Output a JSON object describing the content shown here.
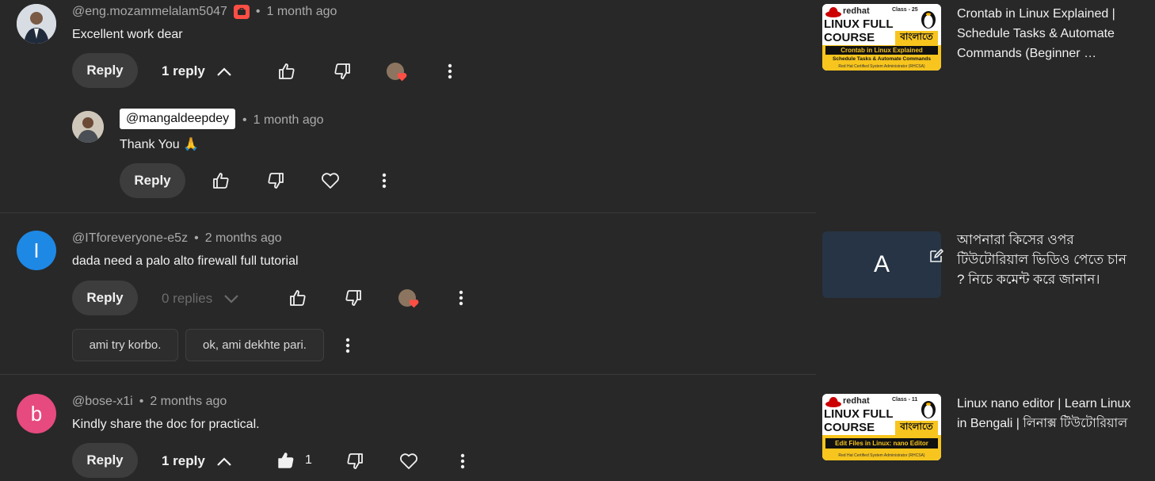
{
  "comments": [
    {
      "author": "@eng.mozammelalam5047",
      "time": "1 month ago",
      "text": "Excellent work dear",
      "reply_label": "Reply",
      "replies_label": "1 reply"
    },
    {
      "author": "@ITforeveryone-e5z",
      "avatar_letter": "I",
      "avatar_color": "#1e88e5",
      "time": "2 months ago",
      "text": "dada need a palo alto firewall full tutorial",
      "reply_label": "Reply",
      "replies_label": "0 replies",
      "suggestions": [
        "ami try korbo.",
        "ok, ami dekhte pari."
      ]
    },
    {
      "author": "@bose-x1i",
      "avatar_letter": "b",
      "avatar_color": "#e64a7f",
      "time": "2 months ago",
      "text": "Kindly share the doc for practical.",
      "reply_label": "Reply",
      "replies_label": "1 reply",
      "like_count": "1"
    }
  ],
  "reply": {
    "author": "@mangaldeepdey",
    "time": "1 month ago",
    "text": "Thank You 🙏",
    "reply_label": "Reply"
  },
  "videos": [
    {
      "title": "Crontab in Linux Explained | Schedule Tasks & Automate Commands (Beginner …",
      "thumb": {
        "brand": "redhat",
        "class_label": "Class - 25",
        "course_line1": "LINUX FULL",
        "course_line2": "COURSE",
        "bengali": "বাংলাতে",
        "topic": "Crontab in Linux Explained",
        "sub": "Schedule Tasks & Automate Commands",
        "footer": "Red Hat Certified System Administrator (RHCSA)"
      }
    },
    {
      "title": "আপনারা কিসের ওপর টিউটোরিয়াল ভিডিও পেতে চান ? নিচে কমেন্ট করে জানান।",
      "thumb_letter": "A",
      "thumb_color": "#263445"
    },
    {
      "title": "Linux nano editor | Learn Linux in Bengali | লিনাক্স টিউটোরিয়াল",
      "thumb": {
        "brand": "redhat",
        "class_label": "Class - 11",
        "course_line1": "LINUX FULL",
        "course_line2": "COURSE",
        "bengali": "বাংলাতে",
        "topic": "Edit Files in Linux: nano Editor",
        "footer": "Red Hat Certified System Administrator (RHCSA)"
      }
    }
  ],
  "colors": {
    "background": "#282828",
    "pill": "#3d3d3d",
    "heart_badge": "#ff4e45",
    "thumb_yellow": "#f7c51e"
  },
  "icons": [
    "thumb-up-icon",
    "thumb-down-icon",
    "heart-icon",
    "more-vert-icon",
    "chevron-up-icon",
    "chevron-down-icon",
    "edit-icon",
    "member-badge-icon"
  ]
}
